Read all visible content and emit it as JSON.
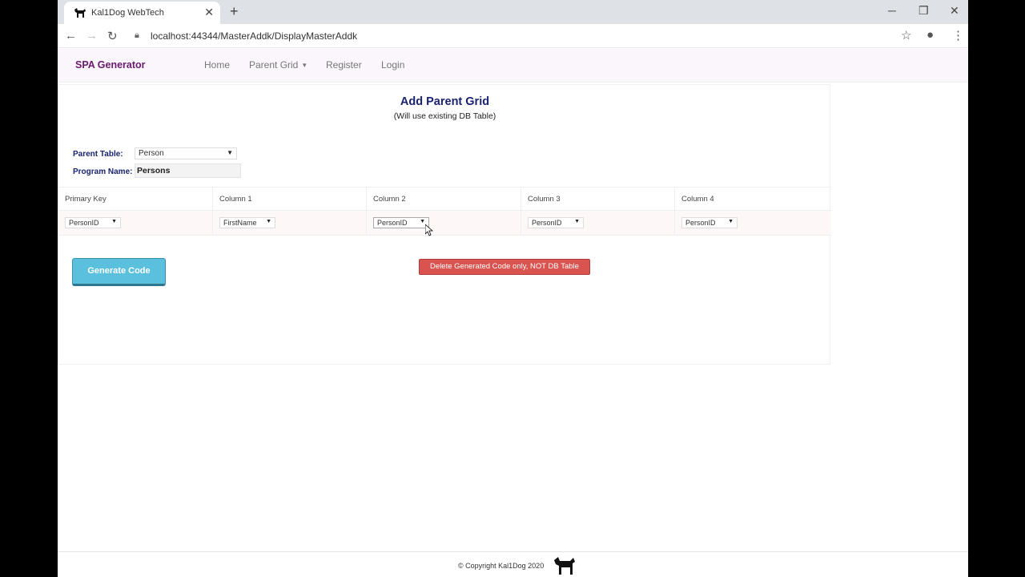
{
  "browser": {
    "tab_title": "Kal1Dog WebTech",
    "tab_close": "✕",
    "new_tab": "+",
    "url": "localhost:44344/MasterAddk/DisplayMasterAddk",
    "icons": [
      "back-icon",
      "forward-icon",
      "reload-icon",
      "lock-icon",
      "star-icon",
      "profile-icon",
      "menu-icon",
      "minimize-icon",
      "restore-icon",
      "close-icon"
    ]
  },
  "navbar": {
    "brand": "SPA Generator",
    "links": [
      "Home",
      "Parent Grid",
      "Register",
      "Login"
    ],
    "brand_color": "#6a1b6f"
  },
  "page": {
    "title": "Add Parent Grid",
    "subtitle": "(Will use existing DB Table)",
    "parent_table_label": "Parent Table:",
    "parent_table_value": "Person",
    "program_name_label": "Program Name:",
    "program_name_value": "Persons"
  },
  "grid": {
    "headers": [
      "Primary Key",
      "Column 1",
      "Column 2",
      "Column 3",
      "Column 4"
    ],
    "values": [
      "PersonID",
      "FirstName",
      "PersonID",
      "PersonID",
      "PersonID"
    ]
  },
  "buttons": {
    "generate": "Generate Code",
    "delete": "Delete Generated Code only, NOT DB Table",
    "generate_color": "#5bc0de",
    "delete_color": "#d9534f"
  },
  "footer": {
    "copyright": "© Copyright Kal1Dog 2020"
  }
}
